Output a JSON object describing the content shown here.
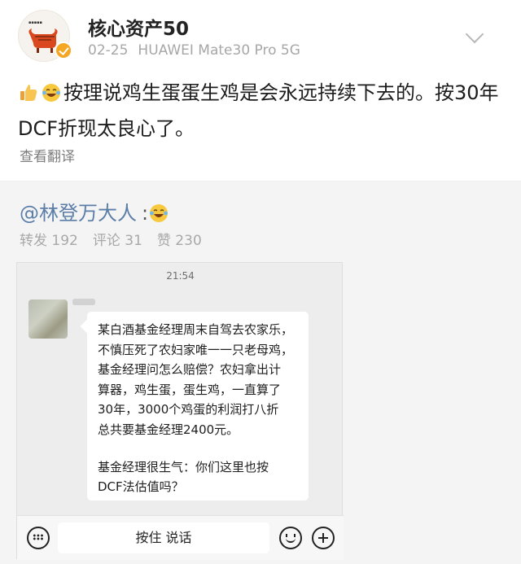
{
  "post": {
    "username": "核心资产50",
    "date": "02-25",
    "device": "HUAWEI Mate30 Pro 5G",
    "text": "按理说鸡生蛋蛋生鸡是会永远持续下去的。按30年DCF折现太良心了。",
    "translate_label": "查看翻译",
    "emojis": [
      "thumbs-up-icon",
      "laughing-face-icon"
    ]
  },
  "repost": {
    "mention": "@林登万大人",
    "mention_suffix": ":",
    "stats": {
      "reposts_label": "转发 192",
      "comments_label": "评论 31",
      "likes_label": "赞 230"
    }
  },
  "chat": {
    "time": "21:54",
    "message_lines": [
      "某白酒基金经理周末自驾去农家乐，",
      "不慎压死了农妇家唯一一只老母鸡，",
      "基金经理问怎么赔偿？农妇拿出计",
      "算器，鸡生蛋，蛋生鸡，一直算了",
      "30年，3000个鸡蛋的利润打八折",
      "总共要基金经理2400元。"
    ],
    "message_lines_2": [
      "基金经理很生气：你们这里也按",
      "DCF法估值吗？"
    ],
    "hold_to_talk": "按住 说话"
  },
  "colors": {
    "mention": "#5b7ea9",
    "meta": "#a7a7a7",
    "repost_background": "#f4f4f4",
    "verified_badge": "#f5a623"
  }
}
